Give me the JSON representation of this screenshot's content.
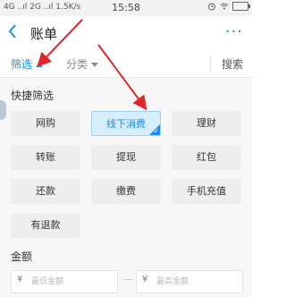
{
  "status_bar": {
    "left": "4G ..ıl 2G ..ıl 1.5K/s",
    "time": "15:58",
    "icons": [
      "alarm-icon",
      "wifi-icon",
      "battery-icon"
    ]
  },
  "titlebar": {
    "back_icon": "chevron-left-icon",
    "title": "账单",
    "more": "···"
  },
  "filterbar": {
    "filter_label": "筛选",
    "category_label": "分类",
    "search_label": "搜索"
  },
  "quick_filter": {
    "title": "快捷筛选",
    "rows": [
      [
        "网购",
        "线下消费",
        "理财"
      ],
      [
        "转账",
        "提现",
        "红包"
      ],
      [
        "还款",
        "缴费",
        "手机充值"
      ],
      [
        "有退款"
      ]
    ],
    "selected": "线下消费"
  },
  "amount": {
    "title": "金额",
    "currency": "¥",
    "min_placeholder": "最低金额",
    "max_placeholder": "最高金额"
  },
  "accent_color": "#1b8ef2",
  "annotation_color": "#e0262a"
}
